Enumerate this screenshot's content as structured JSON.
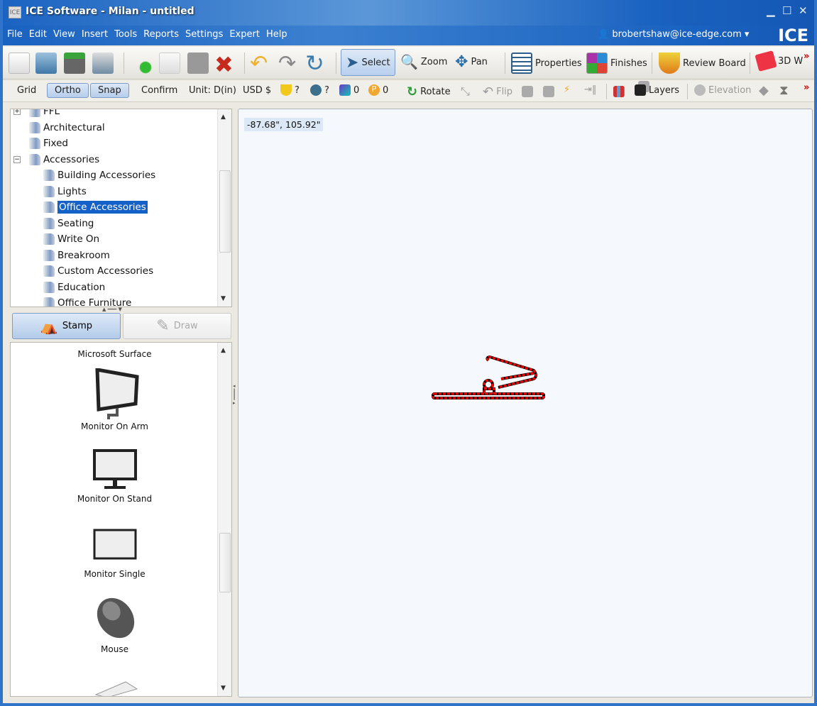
{
  "window": {
    "title": "ICE Software - Milan - untitled",
    "app_icon": "ICE",
    "brand": "ICE",
    "controls": [
      "minimize",
      "maximize",
      "close"
    ]
  },
  "menu": [
    "File",
    "Edit",
    "View",
    "Insert",
    "Tools",
    "Reports",
    "Settings",
    "Expert",
    "Help"
  ],
  "user": {
    "email": "brobertshaw@ice-edge.com"
  },
  "toolbar": {
    "select": "Select",
    "zoom": "Zoom",
    "pan": "Pan",
    "properties": "Properties",
    "finishes": "Finishes",
    "review_board": "Review Board",
    "view3d": "3D W",
    "more": "»"
  },
  "toolbar2": {
    "grid": "Grid",
    "ortho": "Ortho",
    "snap": "Snap",
    "confirm": "Confirm",
    "unit": "Unit: D(in)",
    "currency": "USD $",
    "fire_count": "?",
    "globe_count": "?",
    "shapes_count": "0",
    "p_count": "0",
    "rotate": "Rotate",
    "flip": "Flip",
    "layers": "Layers",
    "elevation": "Elevation",
    "more": "»"
  },
  "tree": {
    "items": [
      {
        "label": "FFL",
        "level": 1,
        "expander": "+"
      },
      {
        "label": "Architectural",
        "level": 1
      },
      {
        "label": "Fixed",
        "level": 1
      },
      {
        "label": "Accessories",
        "level": 1,
        "expander": "-"
      },
      {
        "label": "Building Accessories",
        "level": 2
      },
      {
        "label": "Lights",
        "level": 2
      },
      {
        "label": "Office Accessories",
        "level": 2,
        "selected": true
      },
      {
        "label": "Seating",
        "level": 2
      },
      {
        "label": "Write On",
        "level": 2
      },
      {
        "label": "Breakroom",
        "level": 2
      },
      {
        "label": "Custom Accessories",
        "level": 2
      },
      {
        "label": "Education",
        "level": 2
      },
      {
        "label": "Office Furniture",
        "level": 2
      }
    ]
  },
  "mode": {
    "stamp": "Stamp",
    "draw": "Draw"
  },
  "catalog": [
    "Microsoft Surface",
    "Monitor On Arm",
    "Monitor On Stand",
    "Monitor Single",
    "Mouse"
  ],
  "canvas": {
    "coords": "-87.68\", 105.92\"",
    "selection_color": "#ff0000"
  }
}
